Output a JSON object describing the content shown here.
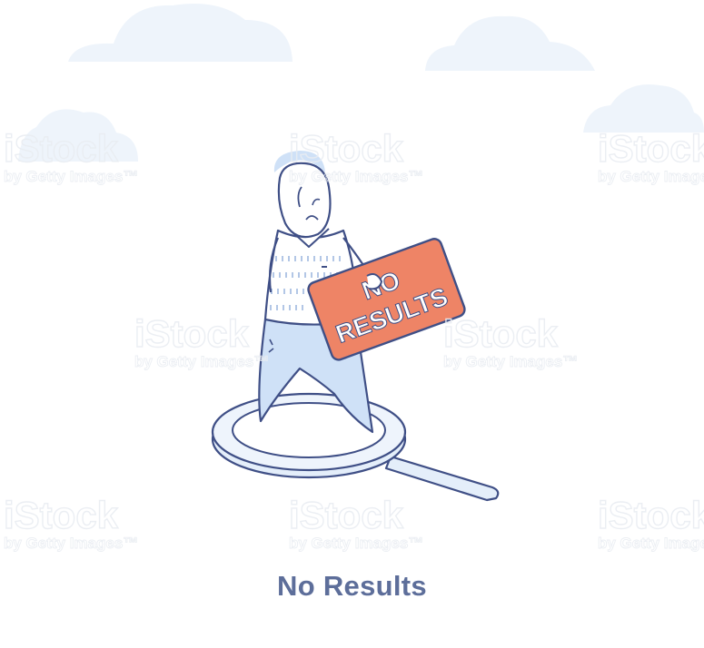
{
  "caption": "No Results",
  "sign": {
    "line1": "NO",
    "line2": "RESULTS"
  },
  "watermark": {
    "brand": "iStock",
    "tagline": "by Getty Images™"
  },
  "colors": {
    "outline": "#3f4f86",
    "body_fill": "#cfe1f7",
    "sign_fill": "#ee8466",
    "cloud_fill": "#eef4fb",
    "caption_color": "#5d6e9a"
  },
  "icons": [
    "magnifying-glass-icon",
    "cloud-icon",
    "sad-face-icon"
  ]
}
